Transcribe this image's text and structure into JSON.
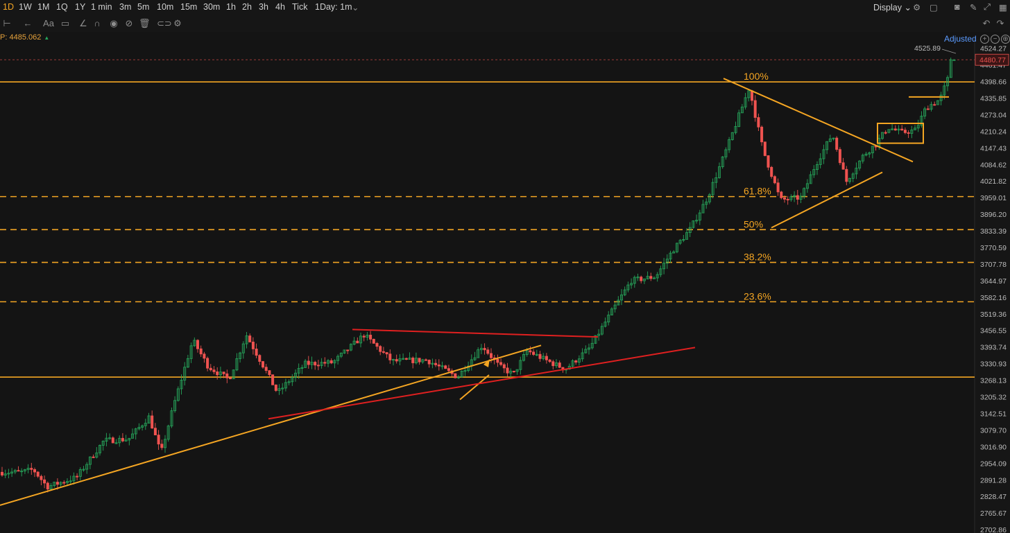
{
  "toolbar": {
    "timeframes": [
      "1D",
      "1W",
      "1M",
      "1Q",
      "1Y",
      "1 min",
      "3m",
      "5m",
      "10m",
      "15m",
      "30m",
      "1h",
      "2h",
      "3h",
      "4h",
      "Tick",
      "1Day: 1m"
    ],
    "active_timeframe": "1D",
    "display_label": "Display"
  },
  "info": {
    "label": "P:",
    "value": "4485.062"
  },
  "adjusted_label": "Adjusted",
  "colors": {
    "up": "#26a65b",
    "down": "#ef5350",
    "fib": "#f5a623",
    "trend_red": "#e02020",
    "background": "#141414"
  },
  "chart_data": {
    "type": "candlestick",
    "y_ticks": [
      "4524.27",
      "4461.47",
      "4398.66",
      "4335.85",
      "4273.04",
      "4210.24",
      "4147.43",
      "4084.62",
      "4021.82",
      "3959.01",
      "3896.20",
      "3833.39",
      "3770.59",
      "3707.78",
      "3644.97",
      "3582.16",
      "3519.36",
      "3456.55",
      "3393.74",
      "3330.93",
      "3268.13",
      "3205.32",
      "3142.51",
      "3079.70",
      "3016.90",
      "2954.09",
      "2891.28",
      "2828.47",
      "2765.67",
      "2702.86"
    ],
    "ylim": [
      2690,
      4560
    ],
    "x_range": [
      0,
      1405
    ],
    "last_price": "4480.77",
    "high_label": "4525.89",
    "high": 4525.89,
    "fib_levels": [
      {
        "label": "100%",
        "price": 4397
      },
      {
        "label": "61.8%",
        "price": 3963
      },
      {
        "label": "50%",
        "price": 3838
      },
      {
        "label": "38.2%",
        "price": 3714
      },
      {
        "label": "23.6%",
        "price": 3565
      }
    ],
    "horizontal_lines": [
      4397,
      3280
    ],
    "waypoints": [
      [
        0,
        2920
      ],
      [
        30,
        2920
      ],
      [
        48,
        2930
      ],
      [
        68,
        2865
      ],
      [
        110,
        2900
      ],
      [
        150,
        3040
      ],
      [
        185,
        3045
      ],
      [
        215,
        3130
      ],
      [
        232,
        2990
      ],
      [
        250,
        3170
      ],
      [
        278,
        3420
      ],
      [
        300,
        3320
      ],
      [
        330,
        3270
      ],
      [
        355,
        3440
      ],
      [
        380,
        3320
      ],
      [
        400,
        3220
      ],
      [
        440,
        3330
      ],
      [
        480,
        3335
      ],
      [
        525,
        3440
      ],
      [
        565,
        3340
      ],
      [
        615,
        3345
      ],
      [
        660,
        3280
      ],
      [
        695,
        3400
      ],
      [
        720,
        3320
      ],
      [
        740,
        3290
      ],
      [
        760,
        3380
      ],
      [
        790,
        3340
      ],
      [
        815,
        3310
      ],
      [
        850,
        3390
      ],
      [
        880,
        3520
      ],
      [
        910,
        3645
      ],
      [
        945,
        3660
      ],
      [
        970,
        3760
      ],
      [
        995,
        3840
      ],
      [
        1020,
        3960
      ],
      [
        1050,
        4160
      ],
      [
        1080,
        4375
      ],
      [
        1100,
        4140
      ],
      [
        1125,
        3950
      ],
      [
        1155,
        3960
      ],
      [
        1175,
        4080
      ],
      [
        1200,
        4200
      ],
      [
        1220,
        4020
      ],
      [
        1245,
        4120
      ],
      [
        1262,
        4160
      ],
      [
        1280,
        4225
      ],
      [
        1300,
        4205
      ],
      [
        1320,
        4215
      ],
      [
        1335,
        4300
      ],
      [
        1355,
        4330
      ],
      [
        1365,
        4400
      ],
      [
        1378,
        4480
      ]
    ],
    "drawings": [
      {
        "color": "#f5a623",
        "points": [
          [
            0,
            2795
          ],
          [
            780,
            3400
          ]
        ]
      },
      {
        "color": "#f5a623",
        "points": [
          [
            1043,
            4410
          ],
          [
            1316,
            4095
          ]
        ]
      },
      {
        "color": "#f5a623",
        "points": [
          [
            1112,
            3845
          ],
          [
            1272,
            4055
          ]
        ]
      },
      {
        "color": "#f5a623",
        "points": [
          [
            1310,
            4340
          ],
          [
            1368,
            4340
          ]
        ]
      },
      {
        "color": "#f5a623",
        "points": [
          [
            663,
            3195
          ],
          [
            705,
            3288
          ]
        ]
      },
      {
        "color": "#e02020",
        "points": [
          [
            387,
            3122
          ],
          [
            1002,
            3392
          ]
        ]
      },
      {
        "color": "#e02020",
        "points": [
          [
            508,
            3460
          ],
          [
            862,
            3432
          ]
        ]
      }
    ],
    "boxes": [
      {
        "color": "#f5a623",
        "x1": 1265,
        "x2": 1331,
        "p1": 4240,
        "p2": 4165
      }
    ]
  }
}
